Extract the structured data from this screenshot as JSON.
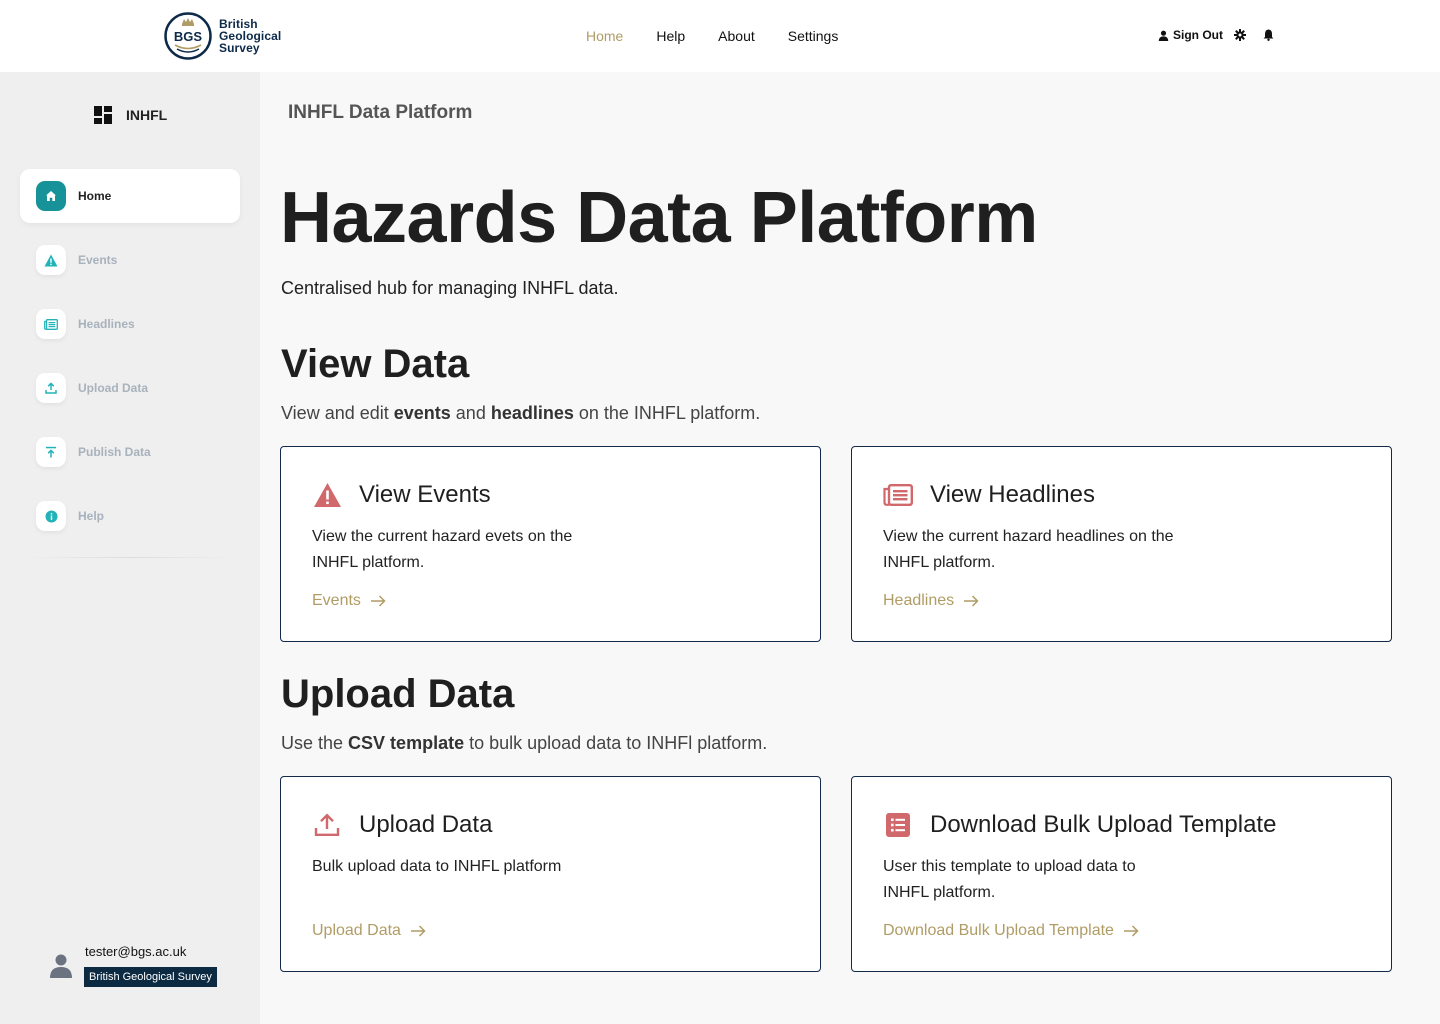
{
  "header": {
    "logo": {
      "abbr": "BGS",
      "line1": "British",
      "line2": "Geological",
      "line3": "Survey"
    },
    "nav": [
      {
        "label": "Home",
        "active": true
      },
      {
        "label": "Help",
        "active": false
      },
      {
        "label": "About",
        "active": false
      },
      {
        "label": "Settings",
        "active": false
      }
    ],
    "sign_out": "Sign Out",
    "accent_color": "#b09c65"
  },
  "sidebar": {
    "brand": "INHFL",
    "items": [
      {
        "label": "Home",
        "icon": "home-icon",
        "active": true
      },
      {
        "label": "Events",
        "icon": "warning-icon",
        "active": false
      },
      {
        "label": "Headlines",
        "icon": "newspaper-icon",
        "active": false
      },
      {
        "label": "Upload Data",
        "icon": "upload-icon",
        "active": false
      },
      {
        "label": "Publish Data",
        "icon": "publish-icon",
        "active": false
      },
      {
        "label": "Help",
        "icon": "info-icon",
        "active": false
      }
    ],
    "user": {
      "email": "tester@bgs.ac.uk",
      "organisation": "British Geological Survey"
    },
    "active_color": "#179299"
  },
  "main": {
    "platform_label": "INHFL Data Platform",
    "title": "Hazards Data Platform",
    "subtitle": "Centralised hub for managing INHFL data.",
    "view_section": {
      "title": "View Data",
      "desc": {
        "pre": "View and edit ",
        "b1": "events",
        "mid": " and ",
        "b2": "headlines",
        "post": " on the INHFL platform."
      },
      "cards": [
        {
          "title": "View Events",
          "text": "View the current hazard evets on the INHFL platform.",
          "link": "Events"
        },
        {
          "title": "View Headlines",
          "text": "View the current hazard headlines on the INHFL platform.",
          "link": "Headlines"
        }
      ]
    },
    "upload_section": {
      "title": "Upload Data",
      "desc": {
        "pre": "Use the ",
        "b1": "CSV template",
        "post": " to bulk upload data to INHFl platform."
      },
      "cards": [
        {
          "title": "Upload Data",
          "text": "Bulk upload data to INHFL platform",
          "link": "Upload Data"
        },
        {
          "title": "Download Bulk Upload Template",
          "text": "User this template to upload data to INHFL platform.",
          "link": "Download Bulk Upload Template"
        }
      ]
    },
    "icon_color": "#d0686c"
  }
}
